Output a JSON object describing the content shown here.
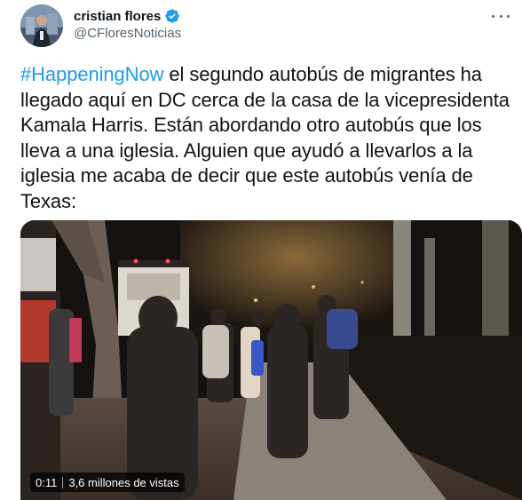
{
  "author": {
    "name": "cristian flores",
    "handle": "@CFloresNoticias",
    "verified": true
  },
  "tweet": {
    "hashtag": "#HappeningNow",
    "body": " el segundo autobús de migrantes ha llegado aquí en DC cerca de la casa de la vicepresidenta Kamala Harris. Están abordando otro autobús que los lleva a una iglesia. Alguien que ayudó a llevarlos a la iglesia me acaba de decir que este autobús venía de Texas:"
  },
  "video": {
    "duration": "0:11",
    "views": "3,6 millones de vistas"
  },
  "colors": {
    "accent": "#1d9bf0",
    "text": "#0f1419",
    "secondary": "#536471"
  },
  "icons": {
    "verified": "verified-badge-icon",
    "more": "more-options-icon"
  }
}
